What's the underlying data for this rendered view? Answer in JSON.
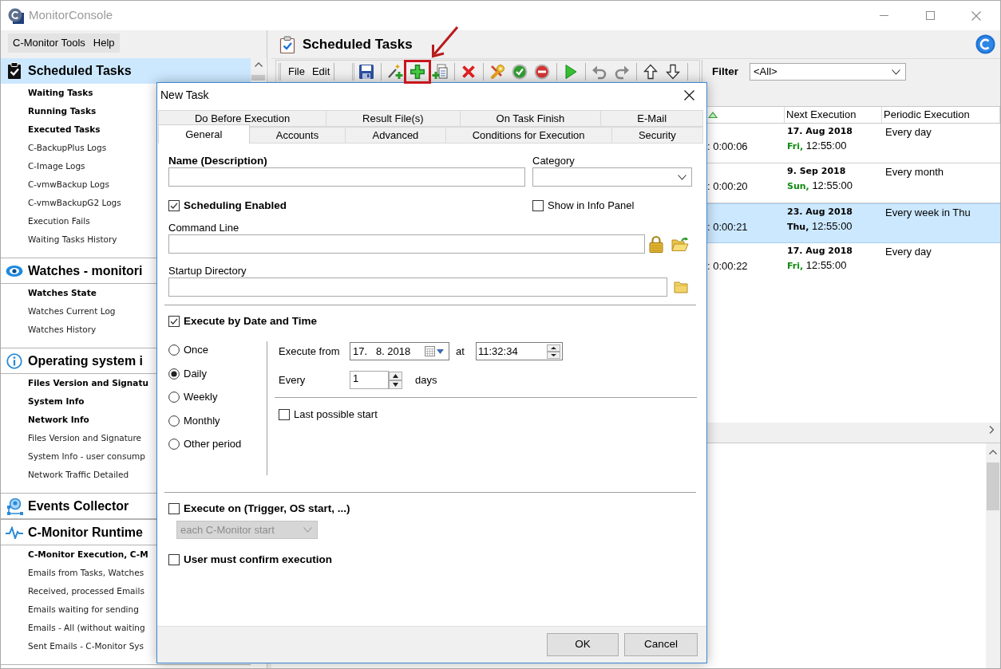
{
  "window": {
    "title": "MonitorConsole"
  },
  "menu_bar": [
    {
      "label": "C-Monitor Tools"
    },
    {
      "label": "Help"
    }
  ],
  "sidebar": [
    {
      "title": "Scheduled Tasks",
      "selected": true,
      "items": [
        {
          "label": "Waiting Tasks",
          "bold": true
        },
        {
          "label": "Running Tasks",
          "bold": true
        },
        {
          "label": "Executed Tasks",
          "bold": true
        },
        {
          "label": "C-BackupPlus Logs",
          "bold": false
        },
        {
          "label": "C-Image Logs",
          "bold": false
        },
        {
          "label": "C-vmwBackup Logs",
          "bold": false
        },
        {
          "label": "C-vmwBackupG2 Logs",
          "bold": false
        },
        {
          "label": "Execution Fails",
          "bold": false
        },
        {
          "label": "Waiting Tasks History",
          "bold": false
        }
      ]
    },
    {
      "title": "Watches - monitori",
      "selected": false,
      "items": [
        {
          "label": "Watches State",
          "bold": true
        },
        {
          "label": "Watches Current Log",
          "bold": false
        },
        {
          "label": "Watches History",
          "bold": false
        }
      ]
    },
    {
      "title": "Operating system i",
      "selected": false,
      "items": [
        {
          "label": "Files Version and Signatu",
          "bold": true
        },
        {
          "label": "System Info",
          "bold": true
        },
        {
          "label": "Network Info",
          "bold": true
        },
        {
          "label": "Files Version and Signature",
          "bold": false
        },
        {
          "label": "System Info - user consump",
          "bold": false
        },
        {
          "label": "Network Traffic Detailed",
          "bold": false
        }
      ]
    },
    {
      "title": "Events Collector",
      "selected": false
    },
    {
      "title": "C-Monitor Runtime",
      "selected": false,
      "items": [
        {
          "label": "C-Monitor Execution, C-M",
          "bold": true
        },
        {
          "label": "Emails from Tasks, Watches",
          "bold": false
        },
        {
          "label": "Received, processed Emails",
          "bold": false
        },
        {
          "label": "Emails waiting for sending",
          "bold": false
        },
        {
          "label": "Emails - All (without waiting",
          "bold": false
        },
        {
          "label": "Sent Emails - C-Monitor Sys",
          "bold": false
        }
      ]
    }
  ],
  "panel": {
    "title": "Scheduled Tasks",
    "toolbar": {
      "menus": [
        {
          "label": "File"
        },
        {
          "label": "Edit"
        }
      ],
      "groups": [
        {
          "buttons": [
            {
              "highlighted": false
            }
          ]
        },
        {
          "buttons": [
            {
              "highlighted": false
            },
            {
              "highlighted": true
            },
            {
              "highlighted": false
            }
          ]
        },
        {
          "buttons": [
            {
              "highlighted": false
            }
          ]
        },
        {
          "buttons": [
            {
              "highlighted": false
            },
            {
              "highlighted": false
            },
            {
              "highlighted": false
            }
          ]
        },
        {
          "buttons": [
            {
              "highlighted": false
            }
          ]
        },
        {
          "buttons": [
            {
              "highlighted": false
            },
            {
              "highlighted": false
            }
          ]
        },
        {
          "buttons": [
            {
              "highlighted": false
            },
            {
              "highlighted": false
            }
          ]
        }
      ]
    },
    "filter": {
      "label": "Filter",
      "value": "<All>"
    },
    "table": {
      "columns": [
        {
          "sorted": true
        },
        {
          "label": "Next Execution",
          "sorted": false
        },
        {
          "label": "Periodic Execution",
          "sorted": false
        }
      ],
      "rows": [
        {
          "column_1": ": 0:00:06",
          "next_date": "17. Aug 2018",
          "next_day": "Fri,",
          "next_time": "12:55:00",
          "periodic": "Every day",
          "selected": false
        },
        {
          "column_1": ": 0:00:20",
          "next_date": "9. Sep 2018",
          "next_day": "Sun,",
          "next_time": "12:55:00",
          "periodic": "Every month",
          "selected": false
        },
        {
          "column_1": ": 0:00:21",
          "next_date": "23. Aug 2018",
          "next_day": "Thu,",
          "next_time": "12:55:00",
          "periodic": "Every week in Thu",
          "selected": true
        },
        {
          "column_1": ": 0:00:22",
          "next_date": "17. Aug 2018",
          "next_day": "Fri,",
          "next_time": "12:55:00",
          "periodic": "Every day",
          "selected": false
        }
      ]
    }
  },
  "dialog": {
    "title": "New Task",
    "tab_rows": [
      {
        "tabs": [
          {
            "label": "Do Before Execution",
            "selected": false
          },
          {
            "label": "Result File(s)",
            "selected": false
          },
          {
            "label": "On Task Finish",
            "selected": false
          },
          {
            "label": "E-Mail",
            "selected": false
          }
        ]
      },
      {
        "tabs": [
          {
            "label": "General",
            "selected": true
          },
          {
            "label": "Accounts",
            "selected": false
          },
          {
            "label": "Advanced",
            "selected": false
          },
          {
            "label": "Conditions for Execution",
            "selected": false
          },
          {
            "label": "Security",
            "selected": false
          }
        ]
      }
    ],
    "name": {
      "label": "Name (Description)"
    },
    "category": {
      "label": "Category"
    },
    "scheduling_enabled": {
      "label": "Scheduling Enabled",
      "checked": true
    },
    "show_in_info_panel": {
      "label": "Show in Info Panel",
      "checked": false
    },
    "command_line": {
      "label": "Command Line"
    },
    "startup_directory": {
      "label": "Startup Directory"
    },
    "execute_by_date": {
      "label": "Execute by Date and Time",
      "checked": true
    },
    "periods": [
      {
        "label": "Once",
        "selected": false
      },
      {
        "label": "Daily",
        "selected": true
      },
      {
        "label": "Weekly",
        "selected": false
      },
      {
        "label": "Monthly",
        "selected": false
      },
      {
        "label": "Other period",
        "selected": false
      }
    ],
    "execute_from": {
      "label": "Execute from",
      "date": "17.   8. 2018",
      "at_label": "at",
      "time": "11:32:34"
    },
    "every": {
      "label": "Every",
      "value": "1",
      "unit": "days"
    },
    "last_possible_start": {
      "label": "Last possible start",
      "checked": false
    },
    "execute_on": {
      "label": "Execute on (Trigger, OS start, ...)",
      "checked": false,
      "option": "each C-Monitor start",
      "disabled": true
    },
    "user_confirm": {
      "label": "User must confirm execution",
      "checked": false
    },
    "buttons": [
      {
        "label": "OK"
      },
      {
        "label": "Cancel"
      }
    ]
  }
}
